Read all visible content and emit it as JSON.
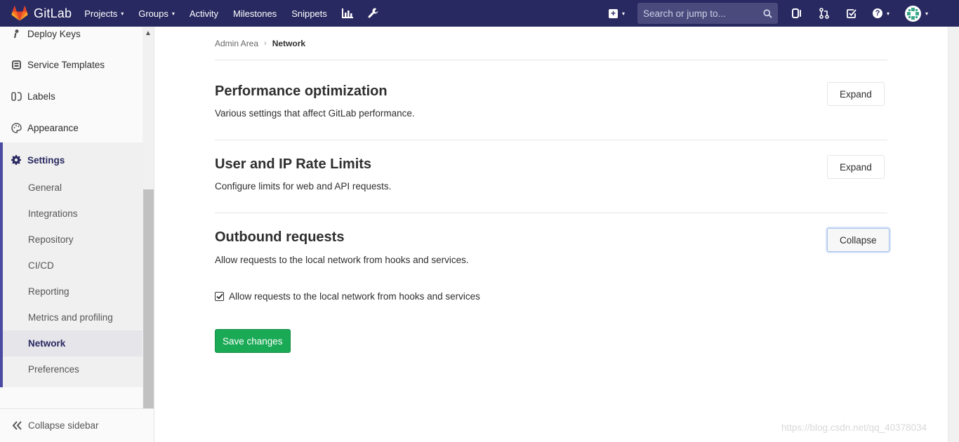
{
  "navbar": {
    "brand": "GitLab",
    "links": [
      {
        "label": "Projects",
        "caret": "▾"
      },
      {
        "label": "Groups",
        "caret": "▾"
      },
      {
        "label": "Activity",
        "caret": ""
      },
      {
        "label": "Milestones",
        "caret": ""
      },
      {
        "label": "Snippets",
        "caret": ""
      }
    ],
    "icons": [
      "chart-icon",
      "wrench-icon"
    ],
    "search_placeholder": "Search or jump to...",
    "right_icons": [
      "issues-icon",
      "merge-requests-icon",
      "todos-icon",
      "help-icon",
      "user-avatar"
    ],
    "colors": {
      "navbar": "#292961",
      "accent": "#4b4ba3",
      "save": "#1aaa55"
    }
  },
  "sidebar": {
    "items": [
      {
        "label": "Deploy Keys",
        "icon": "key-icon"
      },
      {
        "label": "Service Templates",
        "icon": "template-icon"
      },
      {
        "label": "Labels",
        "icon": "labels-icon"
      },
      {
        "label": "Appearance",
        "icon": "palette-icon"
      }
    ],
    "settings": {
      "label": "Settings",
      "icon": "gear-icon",
      "subitems": [
        {
          "label": "General"
        },
        {
          "label": "Integrations"
        },
        {
          "label": "Repository"
        },
        {
          "label": "CI/CD"
        },
        {
          "label": "Reporting"
        },
        {
          "label": "Metrics and profiling"
        },
        {
          "label": "Network",
          "active": true
        },
        {
          "label": "Preferences"
        }
      ]
    },
    "collapse_label": "Collapse sidebar"
  },
  "breadcrumb": {
    "parent": "Admin Area",
    "current": "Network"
  },
  "sections": [
    {
      "title": "Performance optimization",
      "description": "Various settings that affect GitLab performance.",
      "button": "Expand"
    },
    {
      "title": "User and IP Rate Limits",
      "description": "Configure limits for web and API requests.",
      "button": "Expand"
    },
    {
      "title": "Outbound requests",
      "description": "Allow requests to the local network from hooks and services.",
      "button": "Collapse"
    }
  ],
  "outbound": {
    "checkbox_label": "Allow requests to the local network from hooks and services",
    "checked": true,
    "save_label": "Save changes"
  },
  "watermark": "https://blog.csdn.net/qq_40378034"
}
